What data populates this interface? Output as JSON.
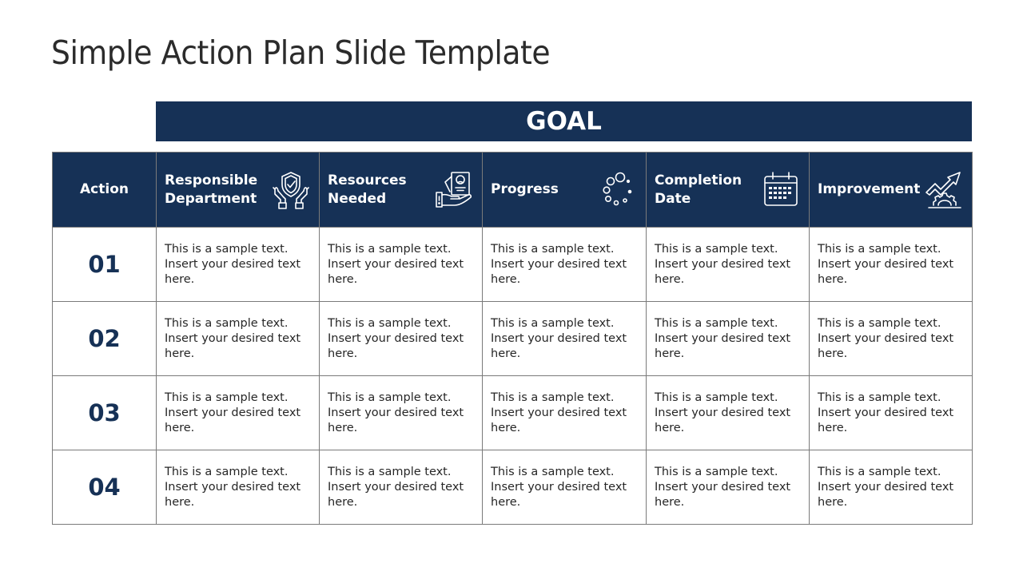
{
  "slide": {
    "title": "Simple Action Plan Slide Template",
    "goal_label": "GOAL"
  },
  "colors": {
    "primary": "#163156",
    "grid": "#7a7a7a",
    "text": "#262626"
  },
  "table": {
    "headers": [
      {
        "label": "Action",
        "icon": ""
      },
      {
        "label": "Responsible Department",
        "icon": "hands-shield-check-icon"
      },
      {
        "label": "Resources Needed",
        "icon": "hand-document-icon"
      },
      {
        "label": "Progress",
        "icon": "loading-circles-icon"
      },
      {
        "label": "Completion Date",
        "icon": "calendar-icon"
      },
      {
        "label": "Improvement",
        "icon": "gear-arrow-up-icon"
      }
    ],
    "rows": [
      {
        "action": "01",
        "cells": [
          "This is a sample text. Insert your desired text here.",
          "This is a sample text. Insert your desired text here.",
          "This is a sample text. Insert your desired text here.",
          "This is a sample text. Insert your desired text here.",
          "This is a sample text. Insert your desired text here."
        ]
      },
      {
        "action": "02",
        "cells": [
          "This is a sample text. Insert your desired text here.",
          "This is a sample text. Insert your desired text here.",
          "This is a sample text. Insert your desired text here.",
          "This is a sample text. Insert your desired text here.",
          "This is a sample text. Insert your desired text here."
        ]
      },
      {
        "action": "03",
        "cells": [
          "This is a sample text. Insert your desired text here.",
          "This is a sample text. Insert your desired text here.",
          "This is a sample text. Insert your desired text here.",
          "This is a sample text. Insert your desired text here.",
          "This is a sample text. Insert your desired text here."
        ]
      },
      {
        "action": "04",
        "cells": [
          "This is a sample text. Insert your desired text here.",
          "This is a sample text. Insert your desired text here.",
          "This is a sample text. Insert your desired text here.",
          "This is a sample text. Insert your desired text here.",
          "This is a sample text. Insert your desired text here."
        ]
      }
    ]
  }
}
